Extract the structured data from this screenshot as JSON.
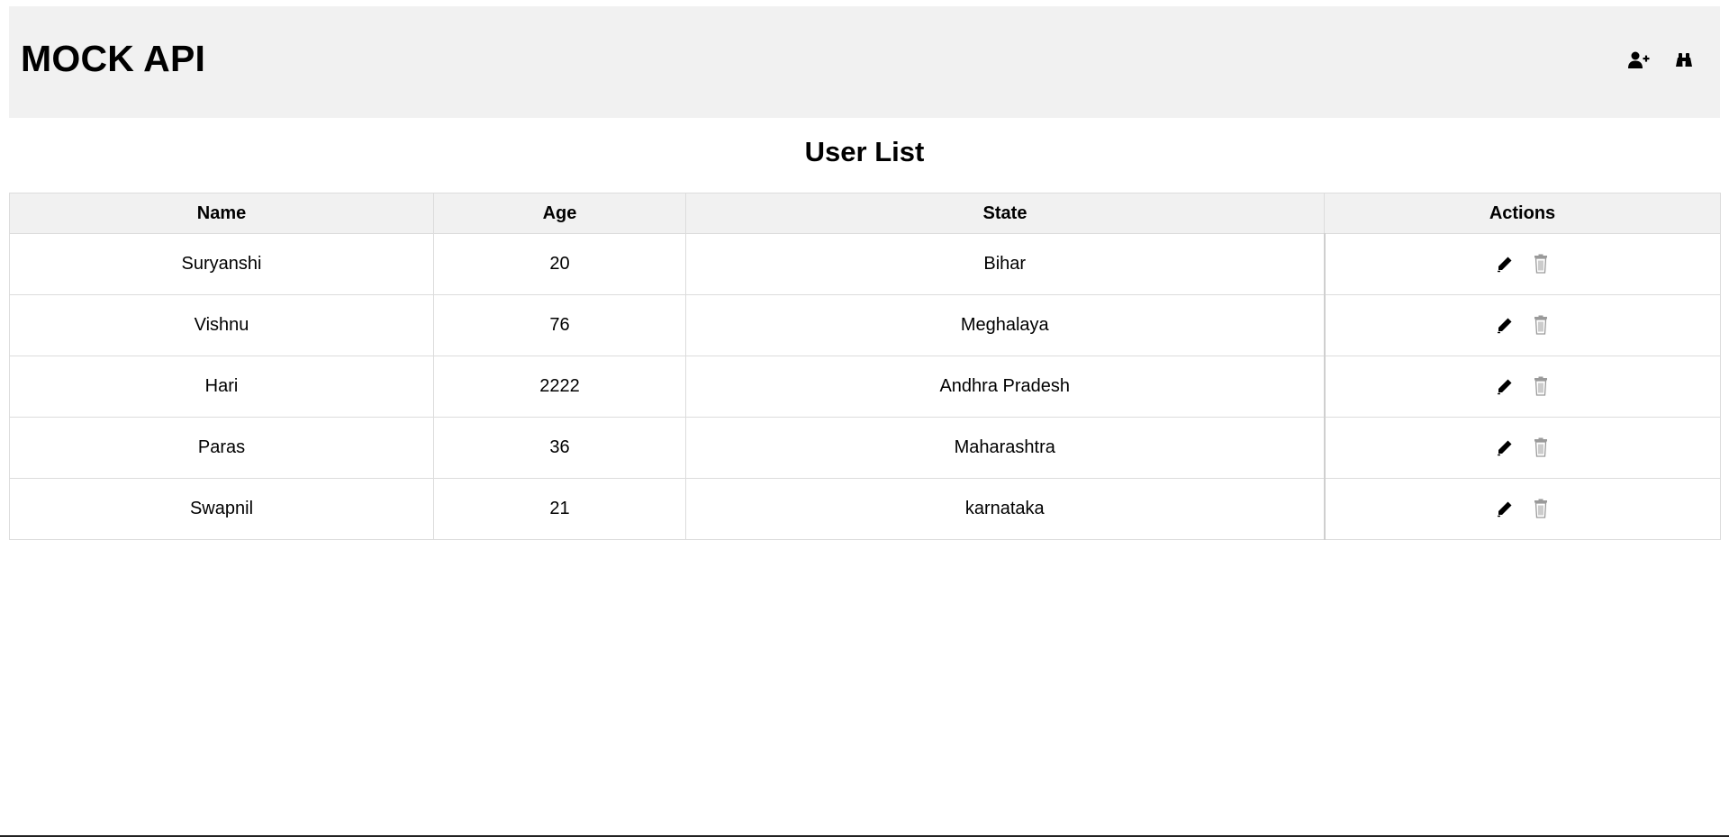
{
  "header": {
    "title": "MOCK API",
    "actions": [
      {
        "icon": "add-user-icon"
      },
      {
        "icon": "binoculars-icon"
      }
    ]
  },
  "main": {
    "title": "User List",
    "table": {
      "columns": [
        "Name",
        "Age",
        "State",
        "Actions"
      ],
      "rows": [
        {
          "name": "Suryanshi",
          "age": "20",
          "state": "Bihar"
        },
        {
          "name": "Vishnu",
          "age": "76",
          "state": "Meghalaya"
        },
        {
          "name": "Hari",
          "age": "2222",
          "state": "Andhra Pradesh"
        },
        {
          "name": "Paras",
          "age": "36",
          "state": "Maharashtra"
        },
        {
          "name": "Swapnil",
          "age": "21",
          "state": "karnataka"
        }
      ],
      "row_actions": [
        {
          "icon": "pencil-icon"
        },
        {
          "icon": "trash-icon"
        }
      ]
    }
  },
  "colors": {
    "header_bg": "#f1f1f1",
    "border": "#dcdcdc",
    "text": "#000000",
    "trash_icon": "#9a9a9a"
  }
}
